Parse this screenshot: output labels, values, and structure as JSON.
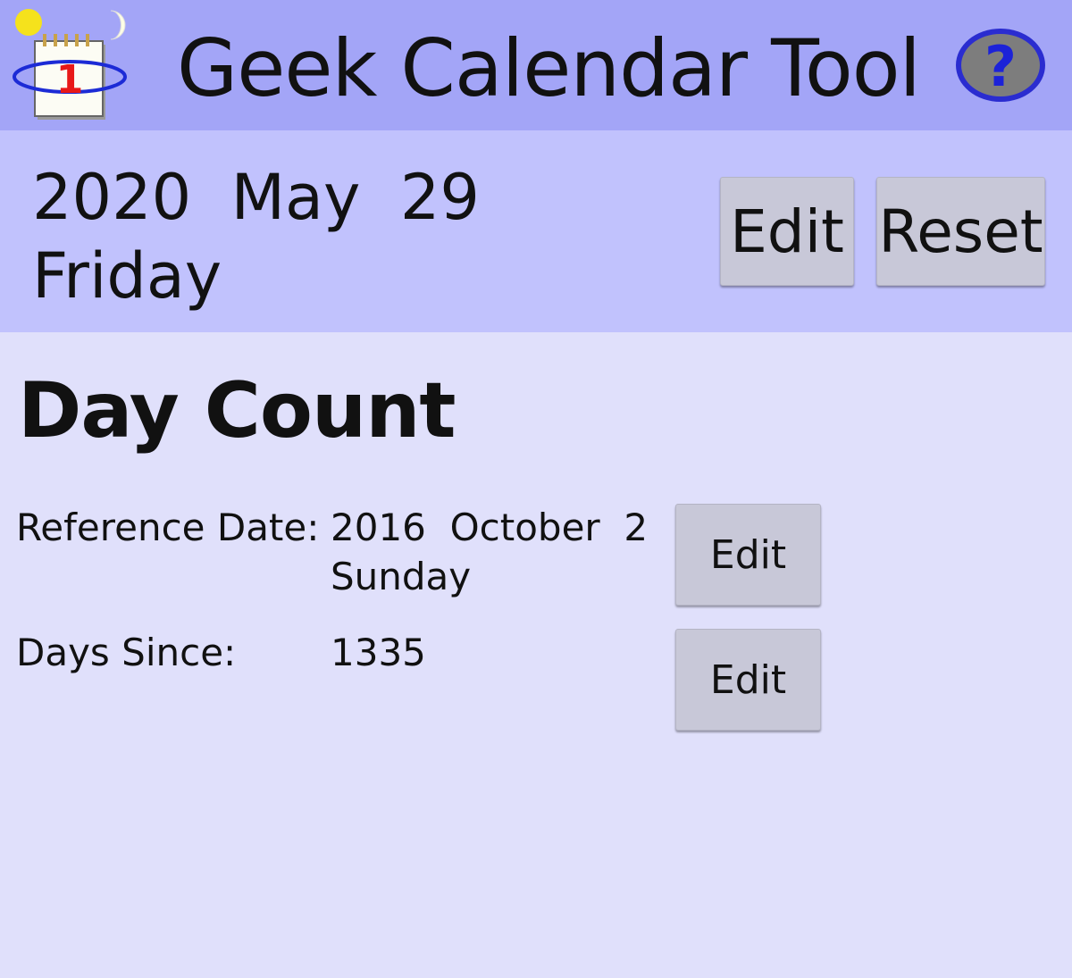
{
  "header": {
    "title": "Geek Calendar Tool",
    "app_icon": "calendar-day-icon",
    "help_icon": "question-mark-icon",
    "calendar_icon_number": "1"
  },
  "current_date": {
    "line1": "2020  May  29",
    "line2": "Friday",
    "edit_label": "Edit",
    "reset_label": "Reset"
  },
  "day_count": {
    "title": "Day Count",
    "reference_label": "Reference Date:",
    "reference_date_line1": "2016  October  2",
    "reference_date_line2": "Sunday",
    "reference_edit_label": "Edit",
    "days_since_label": "Days Since:",
    "days_since_value": "1335",
    "days_edit_label": "Edit"
  },
  "colors": {
    "header_bg": "#a3a5f7",
    "date_bar_bg": "#c1c2fd",
    "content_bg": "#e0e0fb",
    "button_bg": "#c8c8d8"
  }
}
